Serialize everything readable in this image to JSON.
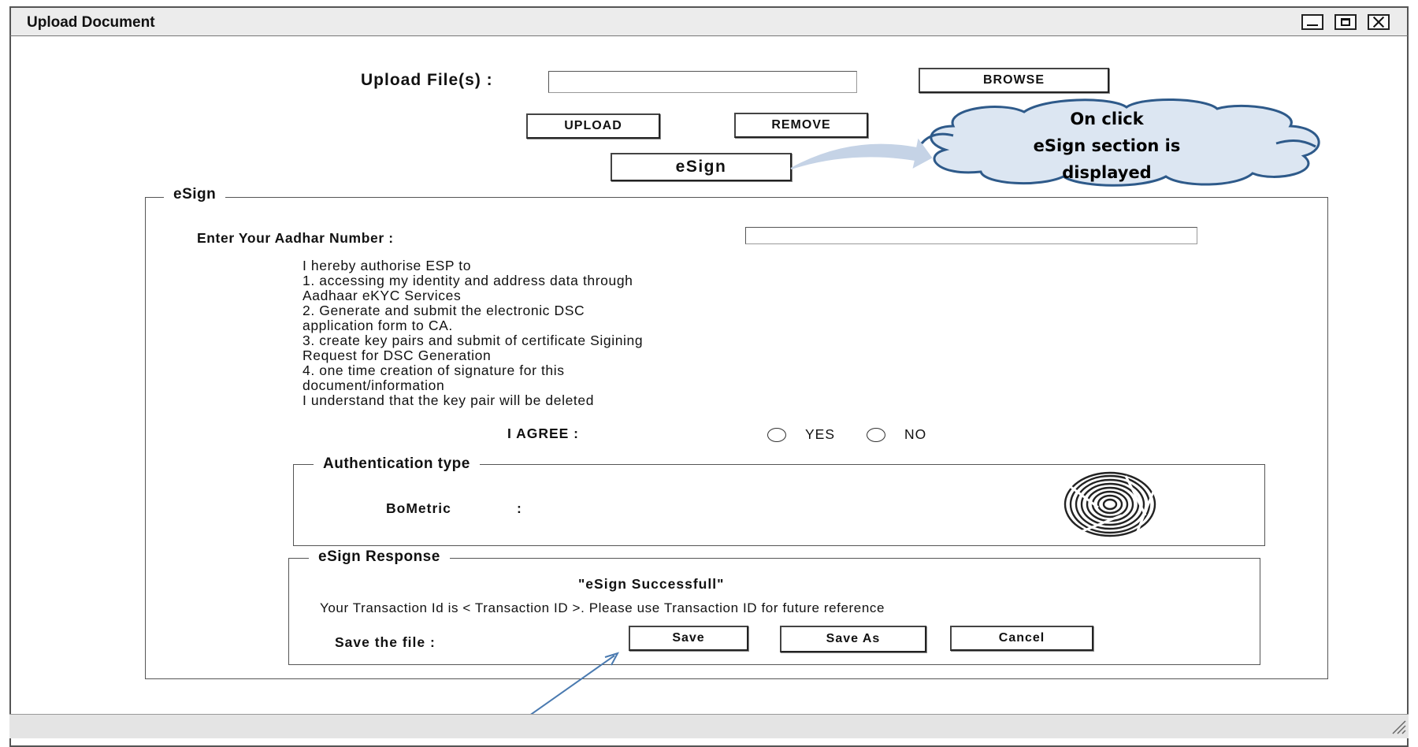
{
  "window": {
    "title": "Upload Document"
  },
  "upload": {
    "label": "Upload File(s) :",
    "file_value": "",
    "browse_label": "BROWSE",
    "upload_label": "UPLOAD",
    "remove_label": "REMOVE",
    "esign_label": "eSign"
  },
  "callout": {
    "line1": "On click",
    "line2": "eSign section is",
    "line3": "displayed"
  },
  "esign_section": {
    "legend": "eSign",
    "aadhar_label": "Enter Your Aadhar Number :",
    "aadhar_value": "",
    "consent_lines": [
      "I hereby authorise ESP to",
      "1. accessing my identity and address data through",
      "Aadhaar eKYC Services",
      "2. Generate and submit the electronic DSC",
      "application form to CA.",
      "3. create key pairs and submit of certificate Sigining",
      "Request for DSC Generation",
      "4. one time creation of signature for this",
      "document/information",
      "I understand that the key pair will be deleted"
    ],
    "agree_label": "I AGREE :",
    "yes_label": "YES",
    "no_label": "NO"
  },
  "auth": {
    "legend": "Authentication type",
    "biometric_label": "BoMetric",
    "biometric_colon": ":",
    "fingerprint_icon": "fingerprint-icon"
  },
  "response": {
    "legend": "eSign Response",
    "status": "\"eSign Successfull\"",
    "transaction_text": "Your Transaction Id is < Transaction ID >. Please use Transaction ID for future reference",
    "save_file_label": "Save the file :",
    "save_label": "Save",
    "save_as_label": "Save As",
    "cancel_label": "Cancel"
  },
  "colors": {
    "cloud_fill": "#dce6f2",
    "cloud_stroke": "#2e5a8a",
    "arrow_line": "#4a7ab0",
    "callout_arrow": "#c5d3e6"
  }
}
